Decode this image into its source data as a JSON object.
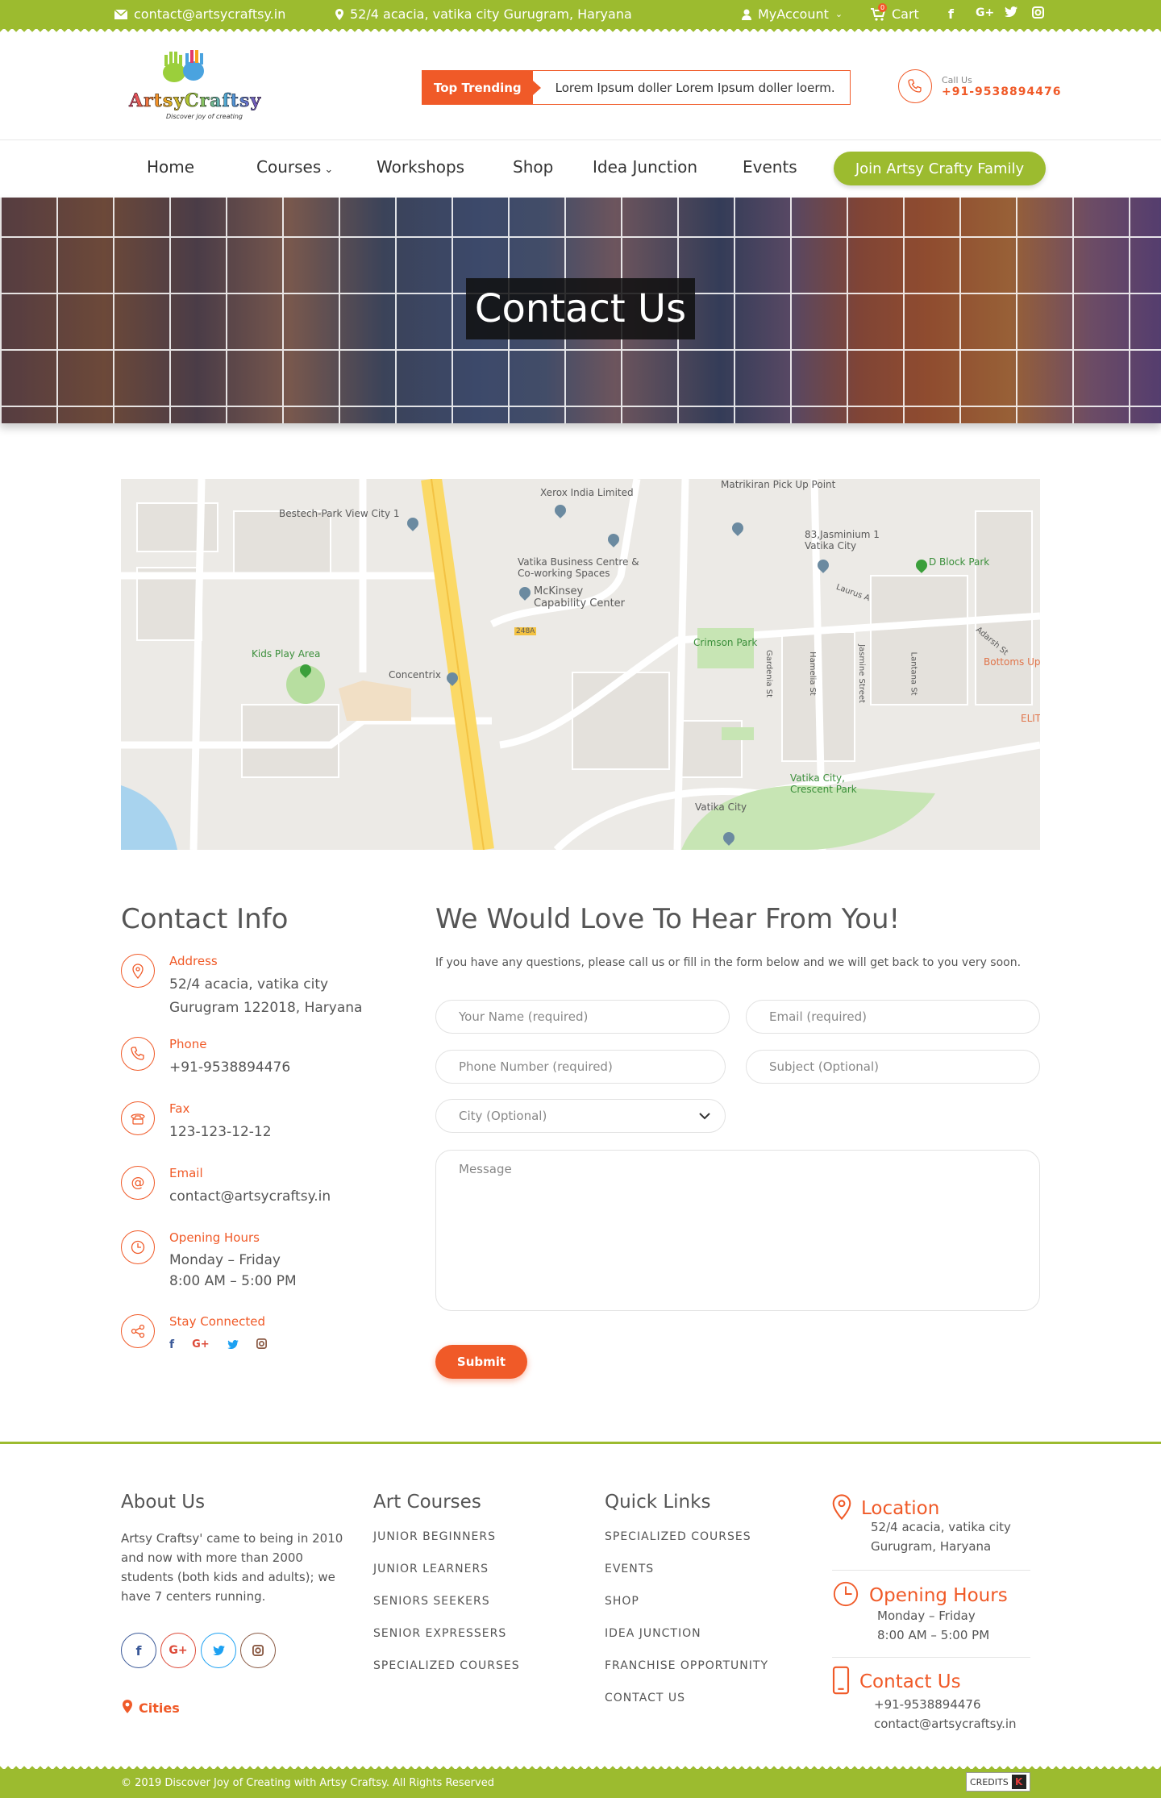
{
  "topbar": {
    "email": "contact@artsycraftsy.in",
    "address": "52/4 acacia, vatika city Gurugram, Haryana",
    "account": "MyAccount",
    "cart": "Cart",
    "cart_count": "0"
  },
  "header": {
    "logo_text": "ArtsyCraftsy",
    "logo_tagline": "Discover joy of creating",
    "trending_tag": "Top Trending",
    "trending_text": "Lorem Ipsum doller Lorem Ipsum doller loerm.",
    "call_label": "Call Us",
    "call_number": "+91-9538894476"
  },
  "nav": {
    "items": [
      "Home",
      "Courses",
      "Workshops",
      "Shop",
      "Idea Junction",
      "Events"
    ],
    "join": "Join Artsy Crafty Family"
  },
  "hero": {
    "title": "Contact Us"
  },
  "map": {
    "labels": [
      "Xerox India Limited",
      "Matrikiran Pick Up Point",
      "Bestech-Park View City 1",
      "83,Jasminium 1 Vatika City",
      "D Block Park",
      "Vatika Business Centre & Co-working Spaces",
      "McKinsey Capability Center",
      "Kids Play Area",
      "Concentrix",
      "Crimson Park",
      "Bottoms Up",
      "Vatika City, Crescent Park",
      "Vatika City",
      "248A",
      "Gardenia St",
      "Hamelia St",
      "Jasmine Street",
      "Lantana St",
      "Laurus A",
      "Adarsh St",
      "ELIT"
    ]
  },
  "contact_info": {
    "title": "Contact Info",
    "address_label": "Address",
    "address_line1": "52/4 acacia, vatika city",
    "address_line2": "Gurugram 122018, Haryana",
    "phone_label": "Phone",
    "phone": "+91-9538894476",
    "fax_label": "Fax",
    "fax": "123-123-12-12",
    "email_label": "Email",
    "email": "contact@artsycraftsy.in",
    "hours_label": "Opening Hours",
    "hours_days": "Monday – Friday",
    "hours_time": "8:00 AM – 5:00 PM",
    "social_label": "Stay Connected"
  },
  "form": {
    "title": "We Would Love To Hear From You!",
    "subtitle": "If you have any questions, please call us or fill in the form below and we will get back to you very soon.",
    "name_placeholder": "Your Name (required)",
    "email_placeholder": "Email (required)",
    "phone_placeholder": "Phone Number (required)",
    "subject_placeholder": "Subject (Optional)",
    "city_placeholder": "City (Optional)",
    "message_placeholder": "Message",
    "submit": "Submit"
  },
  "footer": {
    "about_title": "About Us",
    "about_text": "Artsy Craftsy' came to being in 2010 and now with more than 2000 students (both kids and adults); we have 7 centers running.",
    "cities": "Cities",
    "courses_title": "Art Courses",
    "courses": [
      "JUNIOR BEGINNERS",
      "JUNIOR LEARNERS",
      "SENIORS SEEKERS",
      "SENIOR EXPRESSERS",
      "SPECIALIZED COURSES"
    ],
    "links_title": "Quick Links",
    "links": [
      "SPECIALIZED COURSES",
      "EVENTS",
      "SHOP",
      "IDEA JUNCTION",
      "FRANCHISE OPPORTUNITY",
      "CONTACT US"
    ],
    "location_title": "Location",
    "location_line1": "52/4 acacia, vatika city",
    "location_line2": "Gurugram, Haryana",
    "hours_title": "Opening Hours",
    "hours_days": "Monday – Friday",
    "hours_time": "8:00 AM – 5:00 PM",
    "contact_title": "Contact Us",
    "contact_phone": "+91-9538894476",
    "contact_email": "contact@artsycraftsy.in",
    "copyright": "© 2019 Discover Joy of Creating with Artsy Craftsy. All Rights Reserved",
    "credits": "CREDITS"
  },
  "colors": {
    "green": "#9cbb2f",
    "orange": "#f05a28",
    "facebook": "#3b5998",
    "googleplus": "#dd4b39",
    "twitter": "#1da1f2",
    "instagram": "#8a5a44"
  }
}
